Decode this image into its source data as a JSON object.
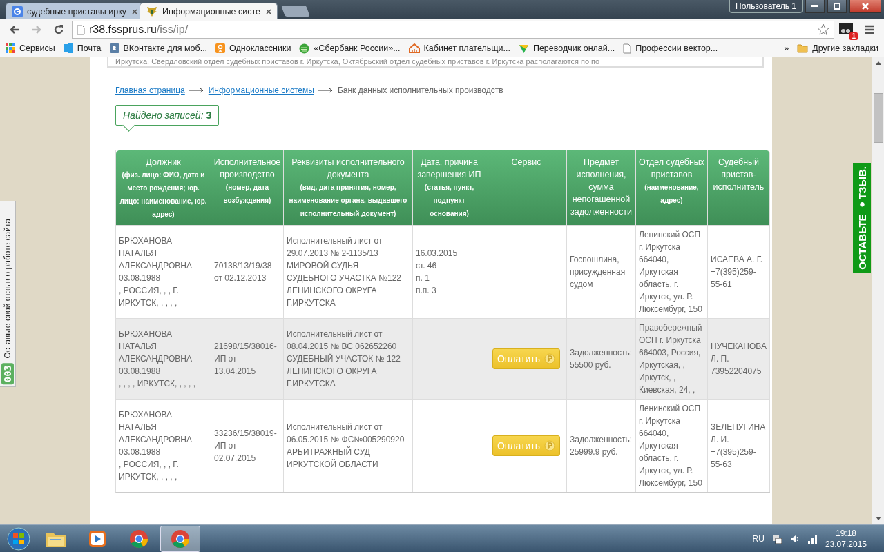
{
  "browser": {
    "tabs": [
      {
        "title": "судебные приставы ирку",
        "kind": "google",
        "selected": false
      },
      {
        "title": "Информационные систе",
        "kind": "emblem",
        "selected": true
      }
    ],
    "user": "Пользователь 1",
    "address": {
      "host": "r38.fssprus.ru",
      "path": "/iss/ip/"
    },
    "extension_badge": "1",
    "bookmarks": [
      {
        "label": "Сервисы",
        "kind": "apps"
      },
      {
        "label": "Почта",
        "kind": "windows"
      },
      {
        "label": "ВКонтакте для моб...",
        "kind": "vk"
      },
      {
        "label": "Одноклассники",
        "kind": "ok"
      },
      {
        "label": "«Сбербанк России»...",
        "kind": "sber"
      },
      {
        "label": "Кабинет плательщи...",
        "kind": "cabinet"
      },
      {
        "label": "Переводчик онлай...",
        "kind": "translate"
      },
      {
        "label": "Профессии вектор...",
        "kind": "page"
      }
    ],
    "overflow": "»",
    "other_bookmarks": "Другие закладки"
  },
  "page": {
    "notice": "Иркутска, Свердловский отдел судебных приставов г. Иркутска, Октябрьский отдел судебных приставов г. Иркутска располагаются по по",
    "breadcrumbs": [
      {
        "label": "Главная страница",
        "kind": "link"
      },
      {
        "label": "Информационные системы",
        "kind": "link"
      },
      {
        "label": "Банк данных исполнительных производств",
        "kind": "current"
      }
    ],
    "found": "Найдено записей: **3**",
    "table": {
      "columns": [
        {
          "title": "Должник",
          "note": "(физ. лицо: ФИО, дата и место рождения; юр. лицо: наименование, юр. адрес)"
        },
        {
          "title": "Исполнительное производство",
          "note": "(номер, дата возбуждения)"
        },
        {
          "title": "Реквизиты исполнительного документа",
          "note": "(вид, дата принятия, номер, наименование органа, выдавшего исполнительный документ)"
        },
        {
          "title": "Дата, причина завершения ИП",
          "note": "(статья, пункт, подпункт основания)"
        },
        {
          "title": "Сервис"
        },
        {
          "title": "Предмет исполнения, сумма непогашенной задолженности"
        },
        {
          "title": "Отдел судебных приставов",
          "note": "(наименование, адрес)"
        },
        {
          "title": "Судебный пристав-исполнитель"
        }
      ],
      "rows": [
        {
          "debtor": "БРЮХАНОВА\nНАТАЛЬЯ\nАЛЕКСАНДРОВНА\n03.08.1988\n, РОССИЯ, , , Г.\nИРКУТСК, , , , ,",
          "proceeding": "70138/13/19/38\nот 02.12.2013",
          "document": "Исполнительный лист от\n29.07.2013 № 2-1135/13\nМИРОВОЙ СУДЬЯ\nСУДЕБНОГО УЧАСТКА №122\nЛЕНИНСКОГО ОКРУГА\nГ.ИРКУТСКА",
          "completion": "16.03.2015\nст. 46\nп. 1\nп.п. 3",
          "subject": "Госпошлина,\nприсужденная\nсудом",
          "department": "Ленинский ОСП\nг. Иркутска\n664040,\nИркутская\nобласть, г.\nИркутск, ул. Р.\nЛюксембург, 150",
          "bailiff": "ИСАЕВА А. Г.\n+7(395)259-\n55-61"
        },
        {
          "debtor": "БРЮХАНОВА\nНАТАЛЬЯ\nАЛЕКСАНДРОВНА\n03.08.1988\n, , , , ИРКУТСК, , , , ,",
          "proceeding": "21698/15/38016-\nИП от\n13.04.2015",
          "document": "Исполнительный лист от\n08.04.2015 № ВС 062652260\nСУДЕБНЫЙ УЧАСТОК № 122\nЛЕНИНСКОГО ОКРУГА\nГ.ИРКУТСКА",
          "service": {
            "kind": "pay",
            "label": "Оплатить"
          },
          "subject": "Задолженность:\n55500 руб.",
          "department": "Правобережный\nОСП г. Иркутска\n664003, Россия,\nИркутская, ,\nИркутск, ,\nКиевская, 24, ,",
          "bailiff": "НУЧЕКАНОВА\nЛ. П.\n73952204075"
        },
        {
          "debtor": "БРЮХАНОВА\nНАТАЛЬЯ\nАЛЕКСАНДРОВНА\n03.08.1988\n, РОССИЯ, , , Г.\nИРКУТСК, , , , ,",
          "proceeding": "33236/15/38019-\nИП от\n02.07.2015",
          "document": "Исполнительный лист от\n06.05.2015 № ФС№005290920\nАРБИТРАЖНЫЙ СУД\nИРКУТСКОЙ ОБЛАСТИ",
          "service": {
            "kind": "pay",
            "label": "Оплатить"
          },
          "subject": "Задолженность:\n25999.9 руб.",
          "department": "Ленинский ОСП\nг. Иркутска\n664040,\nИркутская\nобласть, г.\nИркутск, ул. Р.\nЛюксембург, 150",
          "bailiff": "ЗЕЛЕПУГИНА\nЛ. И.\n+7(395)259-\n55-63"
        }
      ]
    },
    "side_feedback": {
      "label": "Оставьте свой отзыв о работе сайта",
      "count": "003"
    },
    "feedback_tab": "ОСТАВЬТЕ ●ТЗЫВ."
  },
  "taskbar": {
    "apps": [
      {
        "kind": "explorer",
        "selected": false
      },
      {
        "kind": "media",
        "selected": false
      },
      {
        "kind": "chrome",
        "selected": false
      },
      {
        "kind": "chrome",
        "selected": true
      }
    ],
    "language": "RU",
    "time": "19:18",
    "date": "23.07.2015"
  }
}
